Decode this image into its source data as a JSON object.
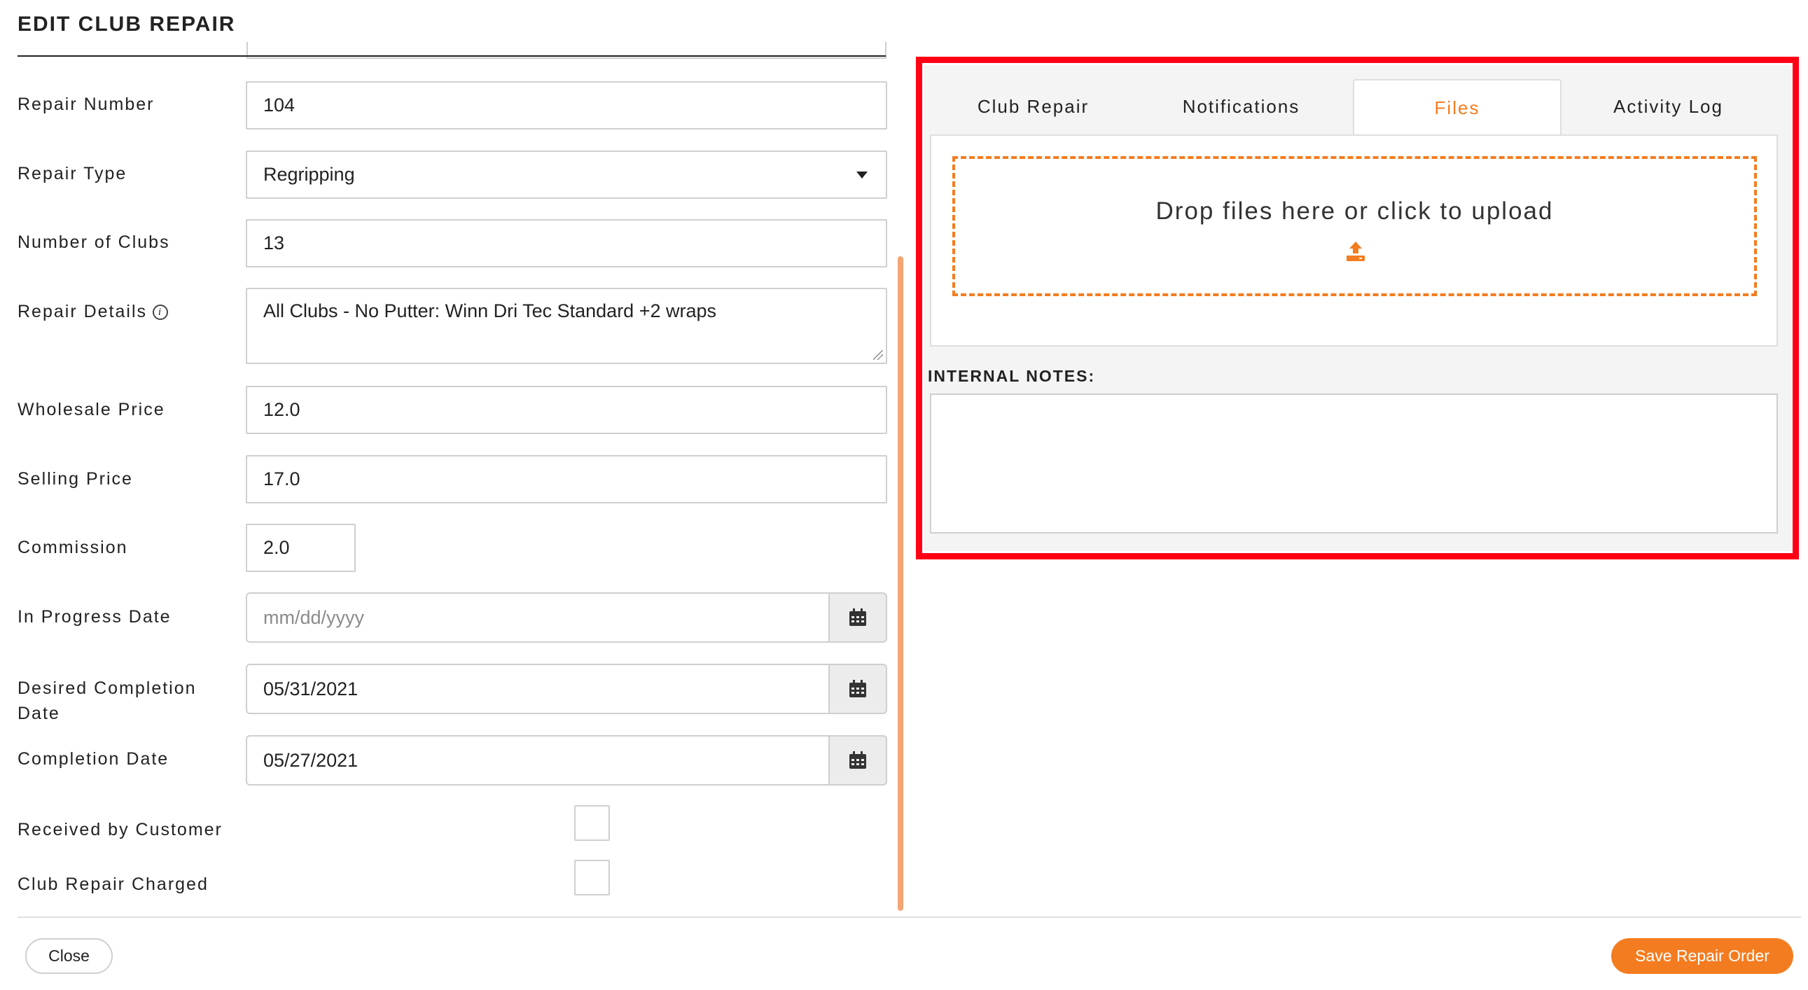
{
  "dialog": {
    "title": "EDIT CLUB REPAIR"
  },
  "form": {
    "repair_number": {
      "label": "Repair Number",
      "value": "104"
    },
    "repair_type": {
      "label": "Repair Type",
      "value": "Regripping"
    },
    "number_of_clubs": {
      "label": "Number of Clubs",
      "value": "13"
    },
    "repair_details": {
      "label": "Repair Details",
      "value": "All Clubs - No Putter: Winn Dri Tec Standard +2 wraps"
    },
    "wholesale_price": {
      "label": "Wholesale Price",
      "value": "12.0"
    },
    "selling_price": {
      "label": "Selling Price",
      "value": "17.0"
    },
    "commission": {
      "label": "Commission",
      "value": "2.0"
    },
    "in_progress_date": {
      "label": "In Progress Date",
      "placeholder": "mm/dd/yyyy"
    },
    "desired_completion_date": {
      "label_line1": "Desired Completion",
      "label_line2": "Date",
      "value": "05/31/2021"
    },
    "completion_date": {
      "label": "Completion Date",
      "value": "05/27/2021"
    },
    "received_by_customer": {
      "label": "Received by Customer",
      "checked": false
    },
    "club_repair_charged": {
      "label": "Club Repair Charged",
      "checked": false
    }
  },
  "panel": {
    "tabs": [
      {
        "label": "Club Repair",
        "active": false
      },
      {
        "label": "Notifications",
        "active": false
      },
      {
        "label": "Files",
        "active": true
      },
      {
        "label": "Activity Log",
        "active": false
      }
    ],
    "dropzone_text": "Drop files here or click to upload",
    "internal_notes_label": "INTERNAL NOTES:",
    "internal_notes_value": ""
  },
  "footer": {
    "close_label": "Close",
    "save_label": "Save Repair Order"
  },
  "colors": {
    "accent": "#f47c20",
    "highlight": "#ff0015"
  },
  "icons": {
    "calendar": "calendar-icon",
    "upload": "upload-icon",
    "info": "info-icon",
    "dropdown": "chevron-down-icon"
  }
}
